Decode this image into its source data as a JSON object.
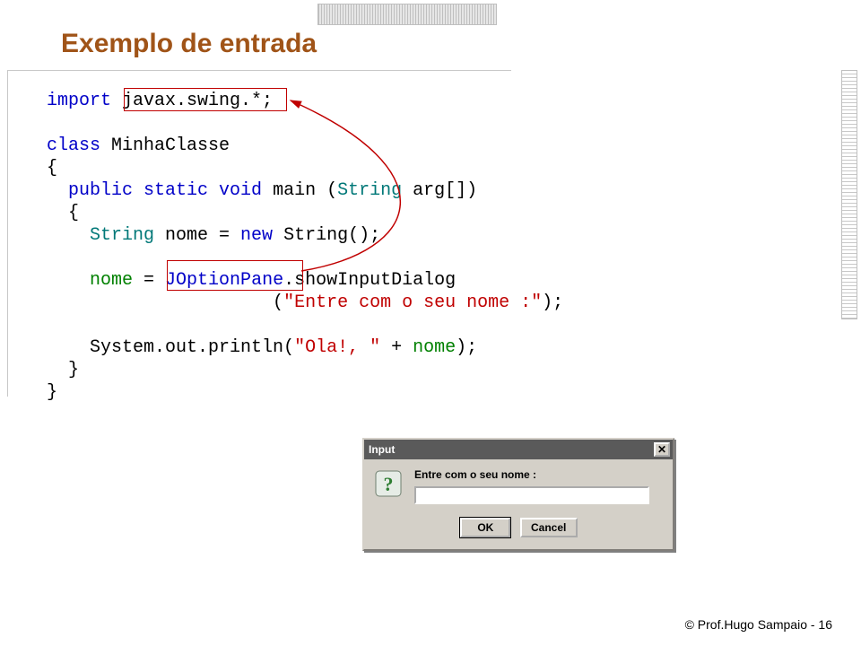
{
  "title": "Exemplo de entrada",
  "code": {
    "import_kw": "import",
    "import_target": "javax.swing.*;",
    "class_kw": "class",
    "class_name": "MinhaClasse",
    "open_brace": "{",
    "main_sig_1": "public static void",
    "main_name": "main",
    "main_sig_2": "(",
    "main_arg_type": "String",
    "main_arg_rest": " arg[])",
    "open_brace2": "{",
    "decl_type": "String",
    "decl_rest": " nome = ",
    "new_kw": "new",
    "new_call": " String();",
    "assign_lhs": "nome",
    "assign_eq": " = ",
    "pane_cls": "JOptionPane",
    "pane_dot": ".",
    "pane_method": "showInputDialog",
    "pane_args_open": "(",
    "pane_literal": "\"Entre com o seu nome :\"",
    "pane_args_close": ");",
    "print_call_1": "System.out.println(",
    "print_literal": "\"Ola!, \"",
    "print_concat": " + ",
    "print_var": "nome",
    "print_close": ");",
    "close_brace2": "}",
    "close_brace": "}"
  },
  "dialog": {
    "window_title": "Input",
    "close_glyph": "✕",
    "label": "Entre com o seu nome :",
    "input_value": "",
    "ok": "OK",
    "cancel": "Cancel"
  },
  "footer": "© Prof.Hugo Sampaio - 16"
}
